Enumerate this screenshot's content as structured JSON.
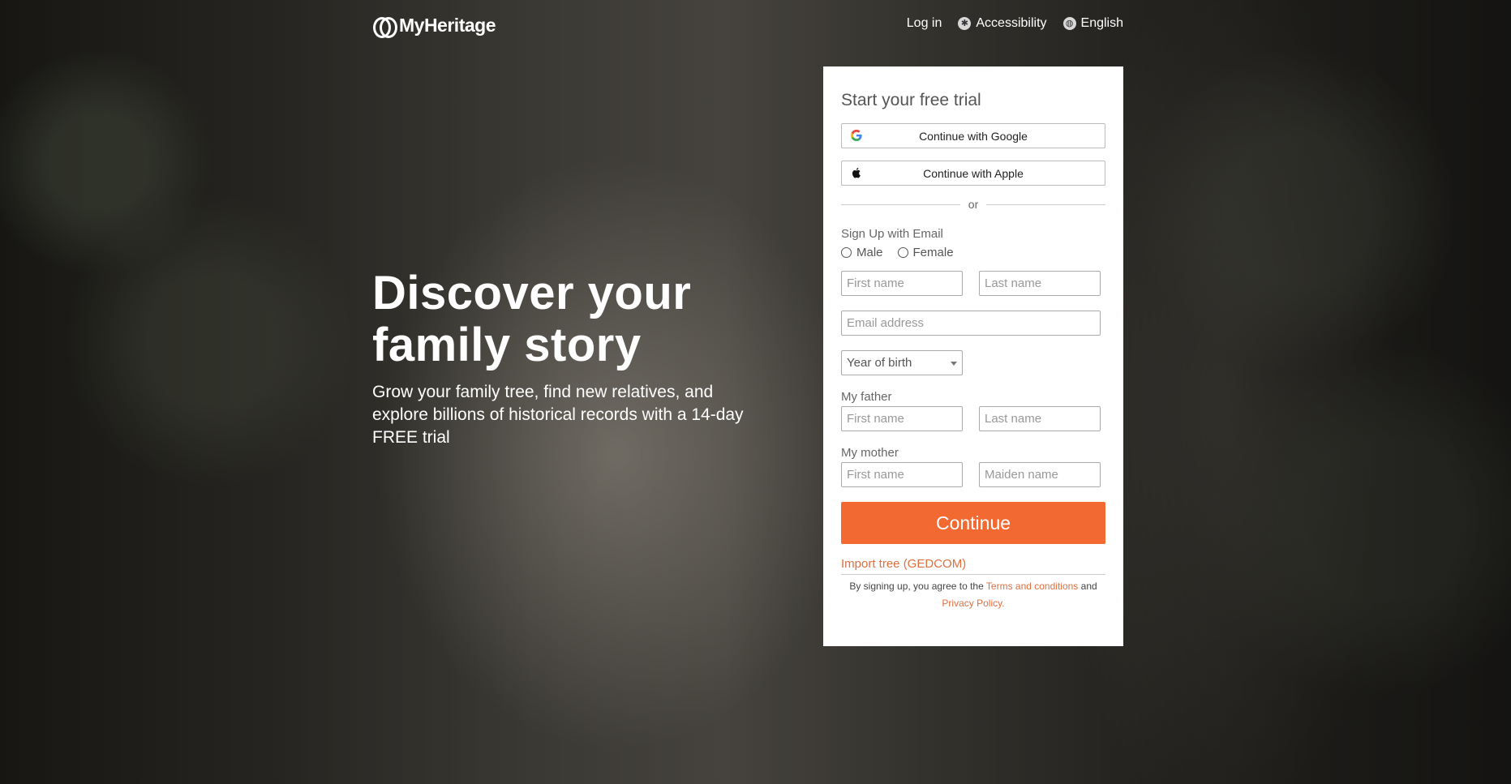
{
  "header": {
    "logo_text": "MyHeritage",
    "login_label": "Log in",
    "accessibility_label": "Accessibility",
    "language_label": "English"
  },
  "hero": {
    "title_line1": "Discover your",
    "title_line2": "family story",
    "subtitle": "Grow your family tree, find new relatives, and explore billions of historical records with a 14-day FREE trial"
  },
  "signup": {
    "title": "Start your free trial",
    "google_label": "Continue with Google",
    "apple_label": "Continue with Apple",
    "or_label": "or",
    "email_section_label": "Sign Up with Email",
    "gender_options": [
      "Male",
      "Female"
    ],
    "first_name_placeholder": "First name",
    "last_name_placeholder": "Last name",
    "email_placeholder": "Email address",
    "year_of_birth_label": "Year of birth",
    "father_label": "My father",
    "father_first_placeholder": "First name",
    "father_last_placeholder": "Last name",
    "mother_label": "My mother",
    "mother_first_placeholder": "First name",
    "mother_maiden_placeholder": "Maiden name",
    "continue_label": "Continue",
    "import_label": "Import tree (GEDCOM)",
    "terms_prefix": "By signing up, you agree to the",
    "terms_link": "Terms and conditions",
    "terms_and": "and",
    "privacy_link": "Privacy Policy",
    "terms_suffix": "."
  },
  "colors": {
    "accent": "#f26a32",
    "link": "#e06f3f"
  },
  "icons": {
    "accessibility": "accessibility-icon",
    "language": "globe-icon",
    "google": "google-icon",
    "apple": "apple-icon"
  }
}
